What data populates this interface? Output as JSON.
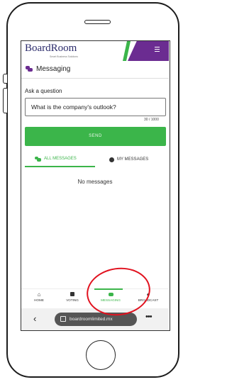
{
  "app": {
    "logo_text": "BoardRoom",
    "tagline": "Smart Business Solutions",
    "title": "Messaging"
  },
  "form": {
    "label": "Ask a question",
    "question_value": "What is the company's outlook?",
    "counter": "30 / 1000",
    "send_label": "SEND"
  },
  "tabs": {
    "all": "ALL MESSAGES",
    "mine": "MY MESSAGES"
  },
  "empty_state": "No messages",
  "nav": {
    "home": "HOME",
    "voting": "VOTING",
    "messaging": "MESSAGING",
    "broadcast": "BROADCAST"
  },
  "browser": {
    "url": "boardroomlimited.mx"
  },
  "colors": {
    "brand_purple": "#6b2c91",
    "brand_green": "#3bb54a",
    "annotation_red": "#e1121f"
  },
  "icons": [
    "menu-icon",
    "chat-bubbles-icon",
    "person-circle-icon",
    "home-icon",
    "ballot-icon",
    "globe-icon",
    "back-arrow-icon",
    "tabs-icon",
    "more-dots-icon"
  ]
}
